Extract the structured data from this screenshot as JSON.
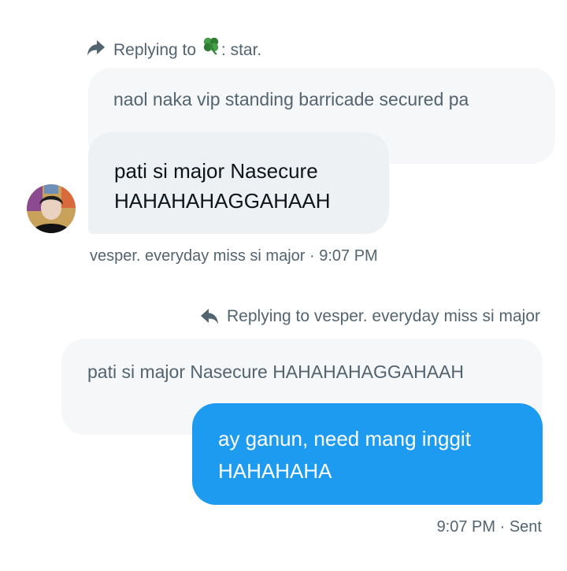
{
  "conversation": {
    "received": {
      "reply_prefix": "Replying to",
      "reply_target_suffix": ": star.",
      "reply_target_icon": "four-leaf-clover-emoji",
      "quoted_text": "naol naka vip standing barricade secured pa",
      "message_line1": "pati si major Nasecure",
      "message_line2": "HAHAHAHAGGAHAAH",
      "sender": "vesper. everyday miss si major",
      "separator": "·",
      "time": "9:07 PM",
      "avatar_icon": "user-avatar"
    },
    "sent": {
      "reply_label": "Replying to vesper. everyday miss si major",
      "quoted_text": "pati si major Nasecure HAHAHAHAGGAHAAH",
      "message_line1": "ay ganun, need mang inggit",
      "message_line2": "HAHAHAHA",
      "time": "9:07 PM",
      "separator": "·",
      "status": "Sent"
    }
  },
  "colors": {
    "accent_blue": "#1d9bf0",
    "muted_text": "#536471",
    "quoted_bg": "#f5f7f8",
    "bubble_gray": "#eef1f3"
  }
}
